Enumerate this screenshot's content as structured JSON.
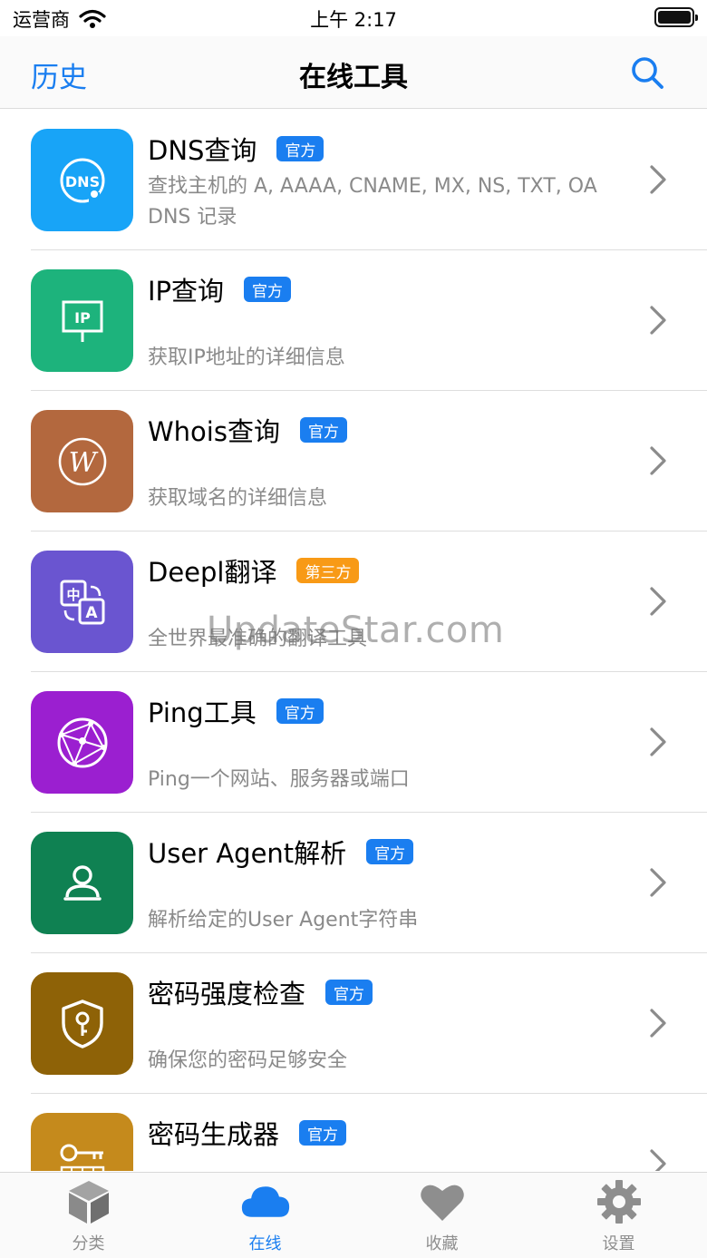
{
  "status_bar": {
    "carrier": "运营商",
    "time": "上午 2:17"
  },
  "nav": {
    "left": "历史",
    "title": "在线工具"
  },
  "tools": [
    {
      "title": "DNS查询",
      "badge": "官方",
      "badge_type": "official",
      "desc": "查找主机的 A, AAAA, CNAME, MX, NS, TXT, OA DNS 记录",
      "icon": "dns-icon",
      "color": "#18a4f7"
    },
    {
      "title": "IP查询",
      "badge": "官方",
      "badge_type": "official",
      "desc": "获取IP地址的详细信息",
      "icon": "ip-sign-icon",
      "color": "#1db37c"
    },
    {
      "title": "Whois查询",
      "badge": "官方",
      "badge_type": "official",
      "desc": "获取域名的详细信息",
      "icon": "whois-w-icon",
      "color": "#b3683e"
    },
    {
      "title": "Deepl翻译",
      "badge": "第三方",
      "badge_type": "third",
      "desc": "全世界最准确的翻译工具",
      "icon": "translate-icon",
      "color": "#6a55d0"
    },
    {
      "title": "Ping工具",
      "badge": "官方",
      "badge_type": "official",
      "desc": "Ping一个网站、服务器或端口",
      "icon": "globe-network-icon",
      "color": "#9b1fd0"
    },
    {
      "title": "User Agent解析",
      "badge": "官方",
      "badge_type": "official",
      "desc": "解析给定的User Agent字符串",
      "icon": "user-agent-icon",
      "color": "#0f8152"
    },
    {
      "title": "密码强度检查",
      "badge": "官方",
      "badge_type": "official",
      "desc": "确保您的密码足够安全",
      "icon": "shield-key-icon",
      "color": "#8e6207"
    },
    {
      "title": "密码生成器",
      "badge": "官方",
      "badge_type": "official",
      "desc": "",
      "icon": "key-generator-icon",
      "color": "#c58a1c"
    }
  ],
  "watermark": "UpdateStar.com",
  "tabs": [
    {
      "label": "分类",
      "icon": "box-icon",
      "active": false
    },
    {
      "label": "在线",
      "icon": "cloud-icon",
      "active": true
    },
    {
      "label": "收藏",
      "icon": "heart-icon",
      "active": false
    },
    {
      "label": "设置",
      "icon": "gear-icon",
      "active": false
    }
  ],
  "colors": {
    "accent": "#1a7ef0",
    "badge_third": "#f89a16",
    "inactive": "#8e8e8e"
  }
}
